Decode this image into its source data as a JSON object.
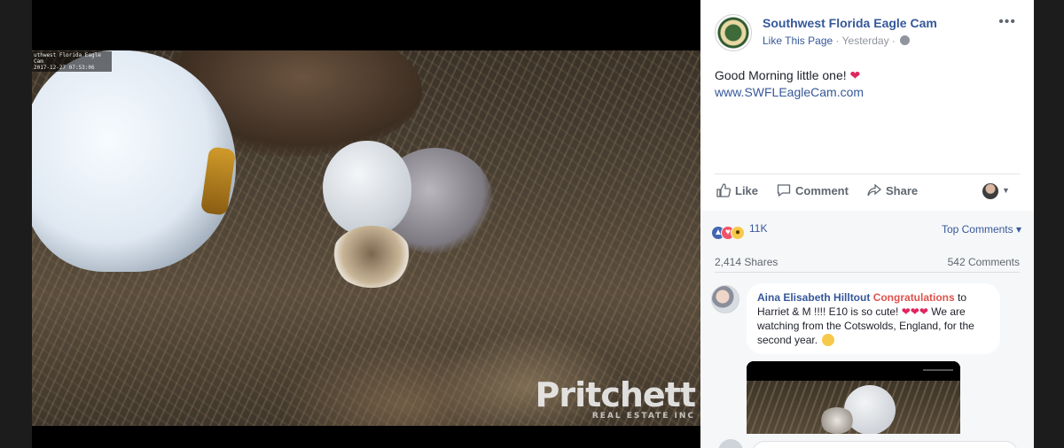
{
  "photo": {
    "cam_stamp": "uthwest Florida Eagle Cam\n2017-12-27 07:53:06",
    "watermark_main": "Pritchett",
    "watermark_sub": "REAL ESTATE INC"
  },
  "post": {
    "page_name": "Southwest Florida Eagle Cam",
    "like_page": "Like This Page",
    "separator": "·",
    "time": "Yesterday",
    "more": "•••",
    "text": "Good Morning little one!",
    "text_emoji": "❤",
    "link": "www.SWFLEagleCam.com"
  },
  "actions": {
    "like": "Like",
    "comment": "Comment",
    "share": "Share",
    "caret": "▼"
  },
  "stats": {
    "reaction_count": "11K",
    "top_comments": "Top Comments ▾",
    "shares": "2,414 Shares",
    "comments": "542 Comments"
  },
  "comment": {
    "author": "Aina Elisabeth Hilltout",
    "tag": "Congratulations",
    "line1": " to Harriet & M !!!! E10 is so cute! ",
    "hearts": "❤❤❤",
    "line2": " We are watching from the Cotswolds, England, for the second year."
  },
  "colors": {
    "link_blue": "#365899",
    "reaction_like": "#4267b2",
    "reaction_love": "#f25268",
    "tag_red": "#e0524d"
  }
}
